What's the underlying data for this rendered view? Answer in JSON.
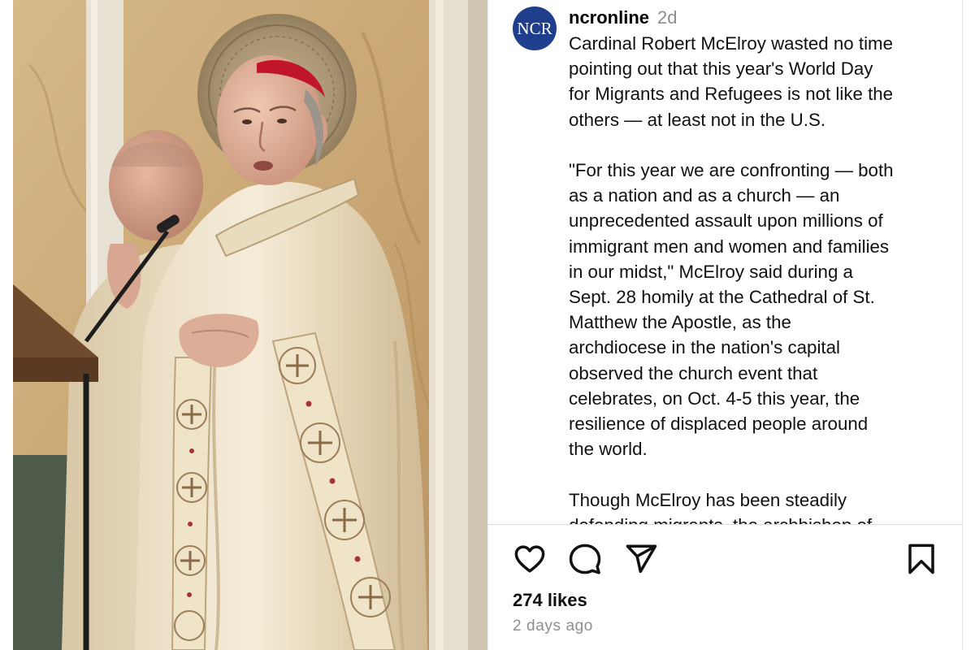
{
  "post": {
    "account": {
      "avatar_text": "NCR",
      "username": "ncronline",
      "time_ago": "2d"
    },
    "caption": {
      "paragraphs": [
        [
          "Cardinal Robert McElroy wasted no time",
          "pointing out that this year's World Day",
          "for Migrants and Refugees is not like the",
          "others — at least not in the U.S."
        ],
        [
          "\"For this year we are confronting — both",
          "as a nation and as a church — an",
          "unprecedented assault upon millions of",
          "immigrant men and women and families",
          "in our midst,\" McElroy said during a",
          "Sept. 28 homily at the Cathedral of St.",
          "Matthew the Apostle, as the",
          "archdiocese in the nation's capital",
          "observed the church event that",
          "celebrates, on Oct. 4-5 this year, the",
          "resilience of displaced people around",
          "the world."
        ],
        [
          "Though McElroy has been steadily",
          "defending migrants, the archbishop of"
        ]
      ]
    },
    "actions": {
      "like_icon": "heart-icon",
      "comment_icon": "comment-icon",
      "share_icon": "send-icon",
      "save_icon": "bookmark-icon"
    },
    "likes_text": "274 likes",
    "posted_text": "2 days ago"
  },
  "colors": {
    "avatar_bg": "#1f3f8c",
    "muted_text": "#8e8e8e",
    "divider": "#dbdbdb"
  },
  "photo": {
    "subject": "photo of clergy in white vestments at a microphone"
  }
}
